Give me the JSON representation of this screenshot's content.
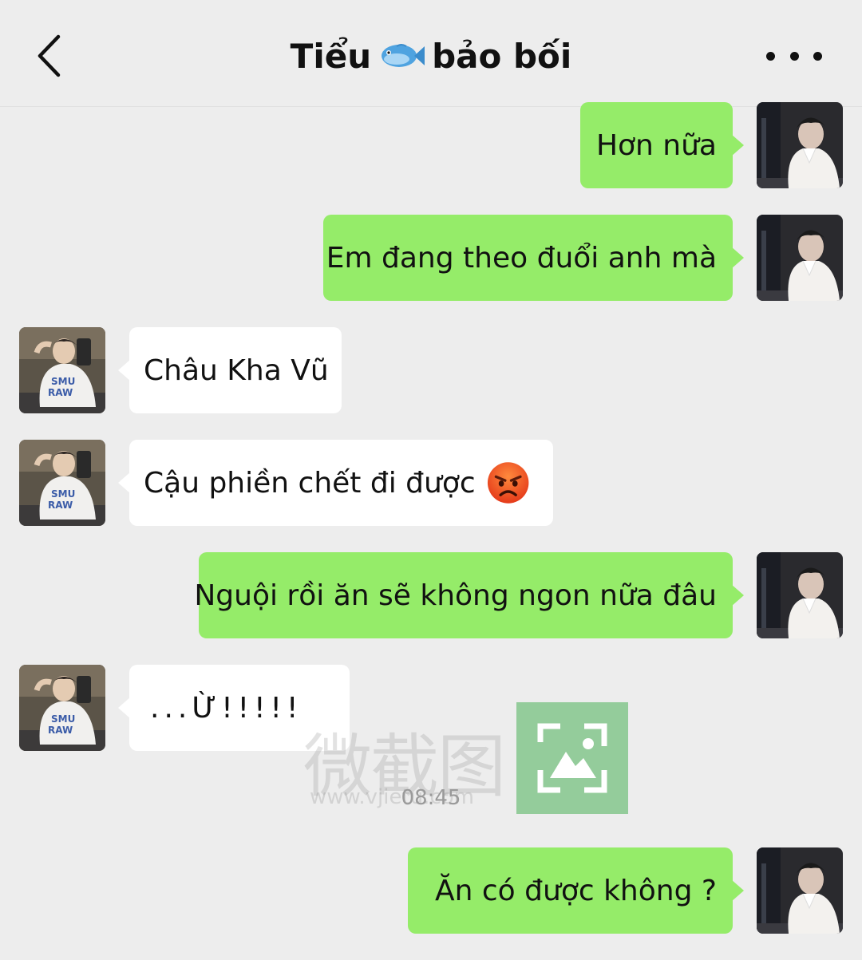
{
  "header": {
    "title_part1": "Tiểu",
    "title_part2": "bảo bối",
    "title_icon": "fish-icon",
    "back_icon": "chevron-left-icon",
    "more_icon": "more-dots-icon"
  },
  "messages": [
    {
      "side": "out",
      "text": "Hơn nữa"
    },
    {
      "side": "out",
      "text": "Em đang theo đuổi anh mà"
    },
    {
      "side": "in",
      "text": "Châu Kha Vũ"
    },
    {
      "side": "in",
      "text": "Cậu phiền chết đi được",
      "emoji": "angry-face-icon"
    },
    {
      "side": "out",
      "text": "Nguội rồi ăn sẽ không ngon nữa đâu"
    },
    {
      "side": "in",
      "text": "...Ừ!!!!!"
    },
    {
      "side": "out",
      "text": "Ăn có được không ?"
    }
  ],
  "timestamp": "08:45",
  "watermark": {
    "text": "微截图",
    "url": "www.vjietu.com"
  },
  "colors": {
    "background": "#ededed",
    "outgoing_bubble": "#95ec69",
    "incoming_bubble": "#ffffff"
  }
}
